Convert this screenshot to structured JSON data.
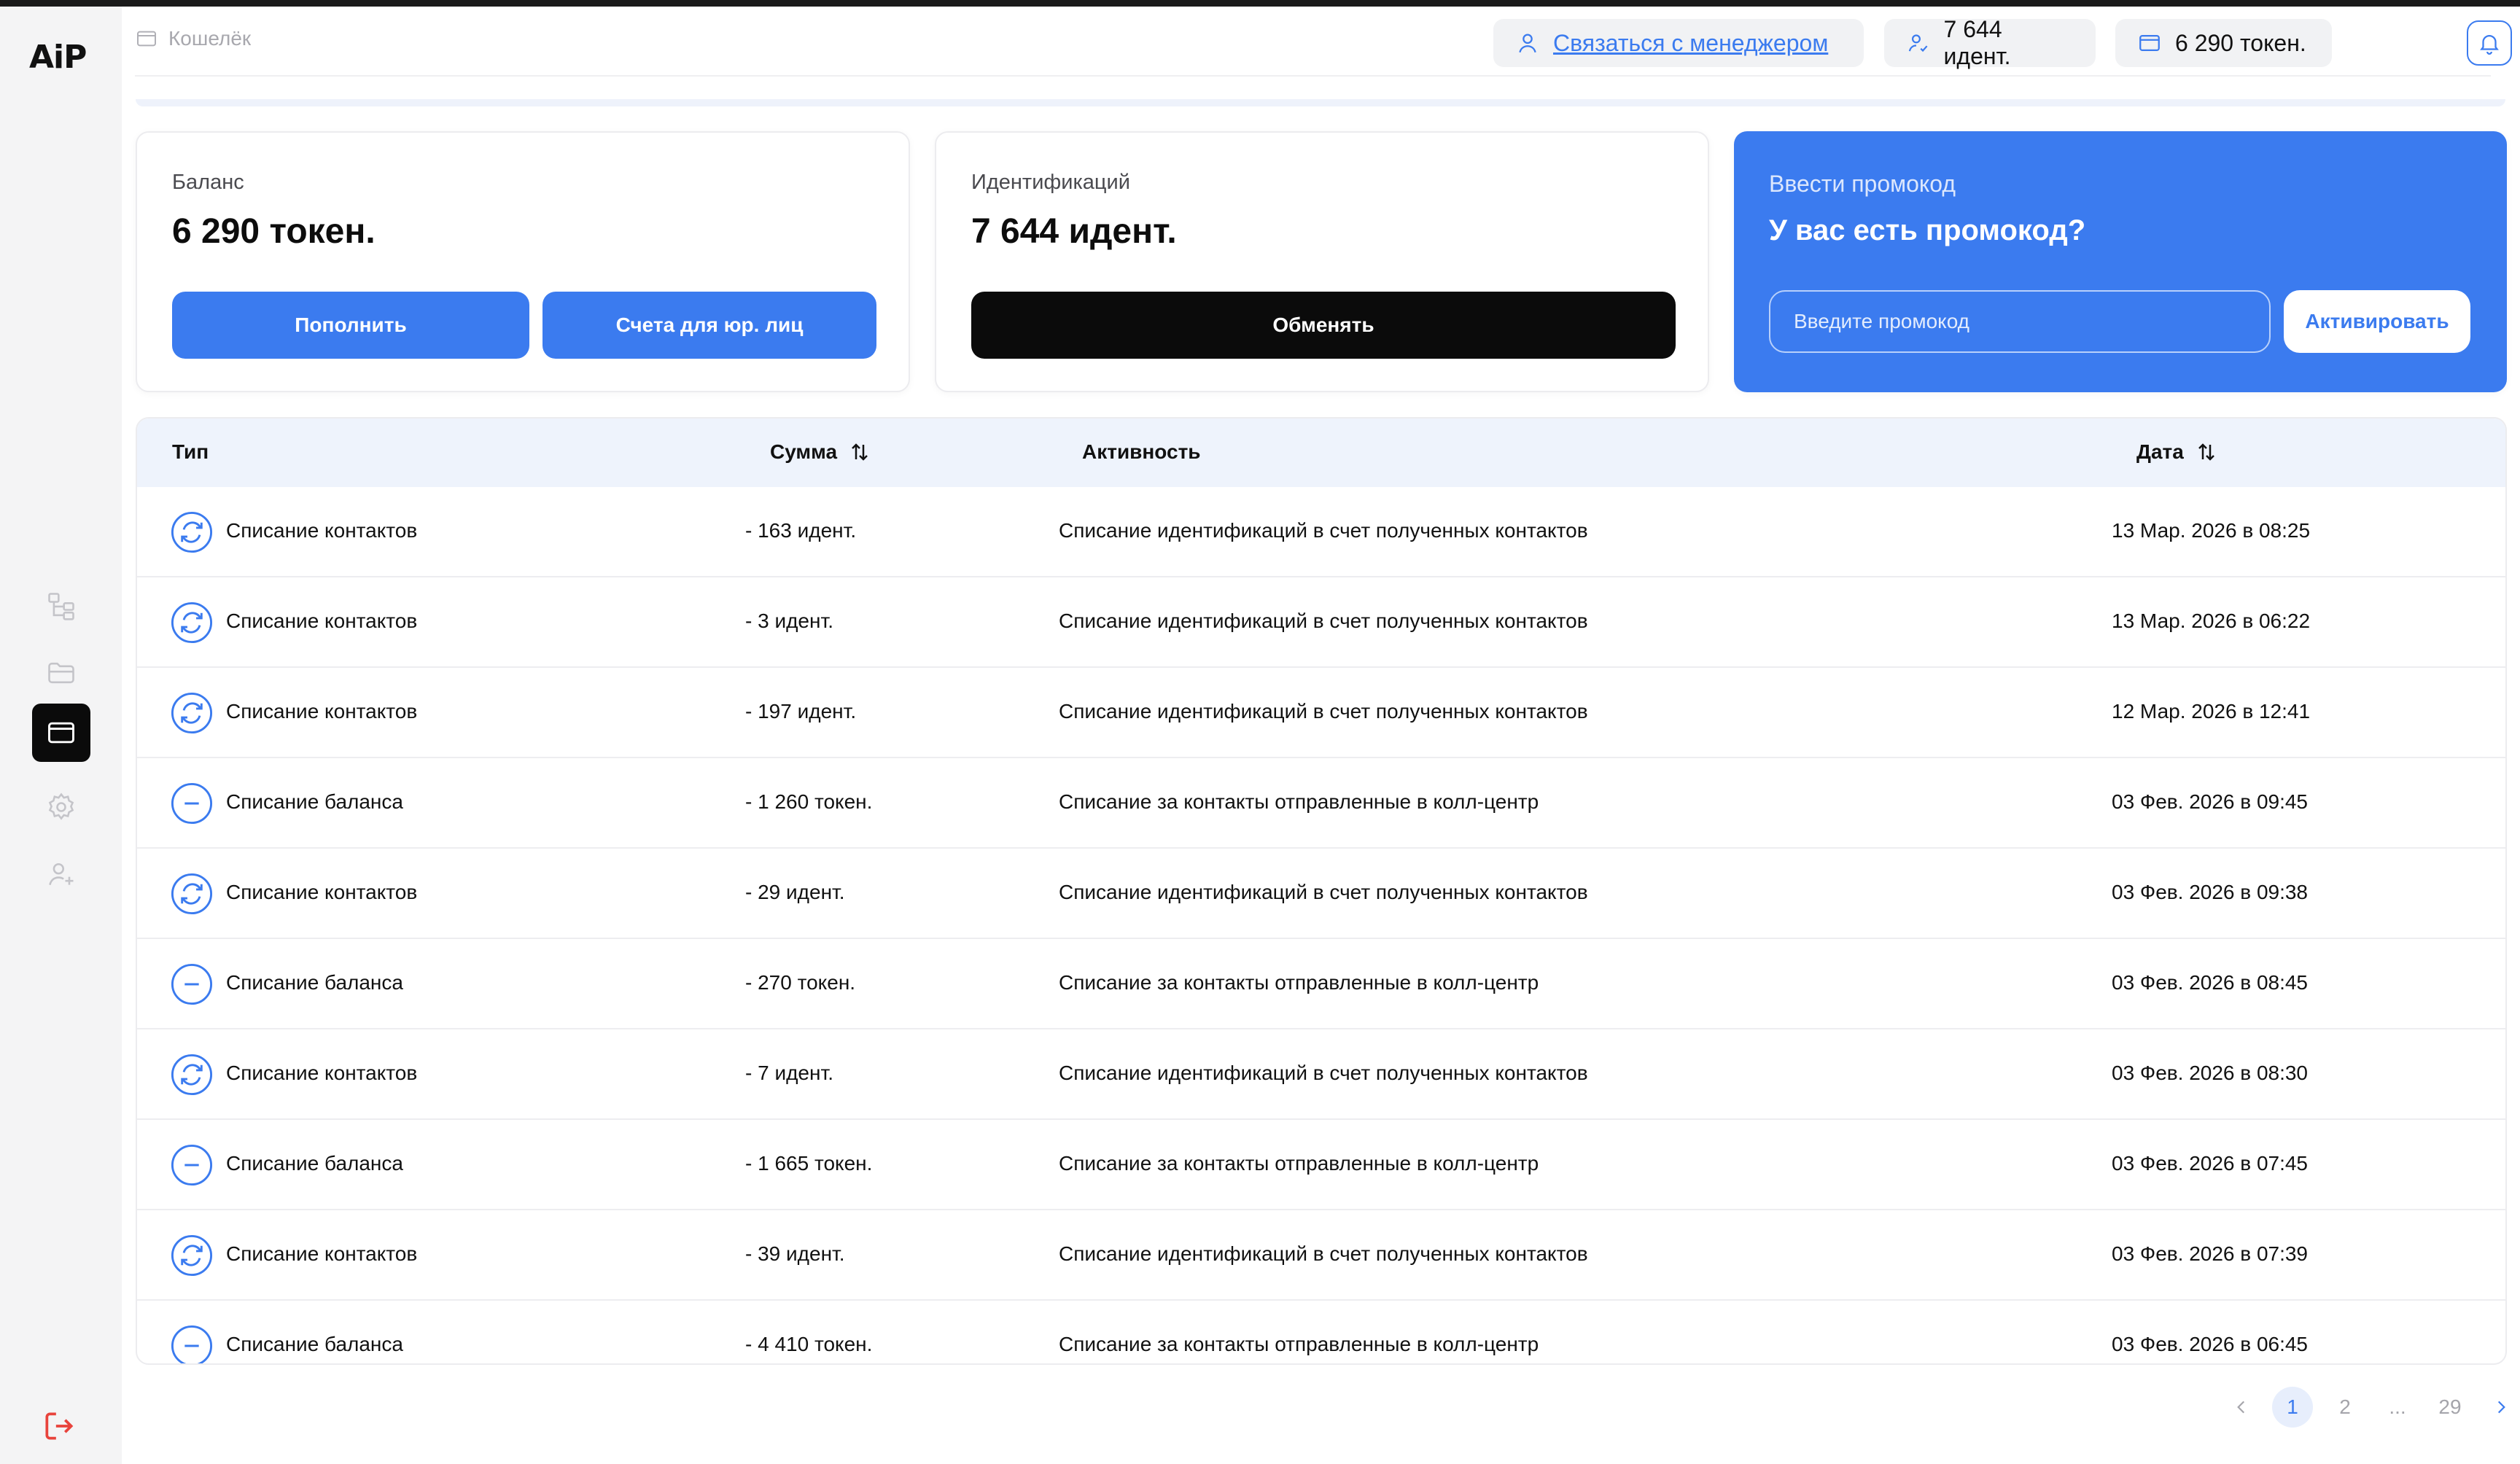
{
  "brand": {
    "logo_text": "AiP"
  },
  "colors": {
    "accent": "#3b7bef",
    "dark": "#0b0b0b",
    "sidebar_bg": "#f4f4f5",
    "table_header_bg": "#eef3fc"
  },
  "sidebar": {
    "items": [
      {
        "name": "tree-icon",
        "active": false
      },
      {
        "name": "folder-icon",
        "active": false
      },
      {
        "name": "wallet-icon",
        "active": true
      },
      {
        "name": "gear-icon",
        "active": false
      },
      {
        "name": "user-add-icon",
        "active": false
      }
    ],
    "logout_icon": "logout-icon"
  },
  "header": {
    "breadcrumb": "Кошелёк",
    "manager_link": "Связаться с менеджером",
    "ident_count": "7 644 идент.",
    "token_count": "6 290 токен."
  },
  "cards": {
    "balance": {
      "label": "Баланс",
      "value": "6 290 токен.",
      "topup_label": "Пополнить",
      "invoice_label": "Счета для юр. лиц"
    },
    "ident": {
      "label": "Идентификаций",
      "value": "7 644 идент.",
      "exchange_label": "Обменять"
    },
    "promo": {
      "label": "Ввести промокод",
      "title": "У вас есть промокод?",
      "placeholder": "Введите промокод",
      "activate_label": "Активировать"
    }
  },
  "table": {
    "columns": {
      "type": "Тип",
      "sum": "Сумма",
      "activity": "Активность",
      "date": "Дата"
    },
    "rows": [
      {
        "kind": "contacts",
        "type": "Списание контактов",
        "sum": "- 163 идент.",
        "activity": "Списание идентификаций в счет полученных контактов",
        "date": "13 Мар. 2026 в 08:25"
      },
      {
        "kind": "contacts",
        "type": "Списание контактов",
        "sum": "- 3 идент.",
        "activity": "Списание идентификаций в счет полученных контактов",
        "date": "13 Мар. 2026 в 06:22"
      },
      {
        "kind": "contacts",
        "type": "Списание контактов",
        "sum": "- 197 идент.",
        "activity": "Списание идентификаций в счет полученных контактов",
        "date": "12 Мар. 2026 в 12:41"
      },
      {
        "kind": "balance",
        "type": "Списание баланса",
        "sum": "- 1 260 токен.",
        "activity": "Списание за контакты отправленные в колл-центр",
        "date": "03 Фев. 2026 в 09:45"
      },
      {
        "kind": "contacts",
        "type": "Списание контактов",
        "sum": "- 29 идент.",
        "activity": "Списание идентификаций в счет полученных контактов",
        "date": "03 Фев. 2026 в 09:38"
      },
      {
        "kind": "balance",
        "type": "Списание баланса",
        "sum": "- 270 токен.",
        "activity": "Списание за контакты отправленные в колл-центр",
        "date": "03 Фев. 2026 в 08:45"
      },
      {
        "kind": "contacts",
        "type": "Списание контактов",
        "sum": "- 7 идент.",
        "activity": "Списание идентификаций в счет полученных контактов",
        "date": "03 Фев. 2026 в 08:30"
      },
      {
        "kind": "balance",
        "type": "Списание баланса",
        "sum": "- 1 665 токен.",
        "activity": "Списание за контакты отправленные в колл-центр",
        "date": "03 Фев. 2026 в 07:45"
      },
      {
        "kind": "contacts",
        "type": "Списание контактов",
        "sum": "- 39 идент.",
        "activity": "Списание идентификаций в счет полученных контактов",
        "date": "03 Фев. 2026 в 07:39"
      },
      {
        "kind": "balance",
        "type": "Списание баланса",
        "sum": "- 4 410 токен.",
        "activity": "Списание за контакты отправленные в колл-центр",
        "date": "03 Фев. 2026 в 06:45"
      }
    ]
  },
  "pagination": {
    "pages": [
      "1",
      "2",
      "...",
      "29"
    ],
    "current": "1"
  }
}
